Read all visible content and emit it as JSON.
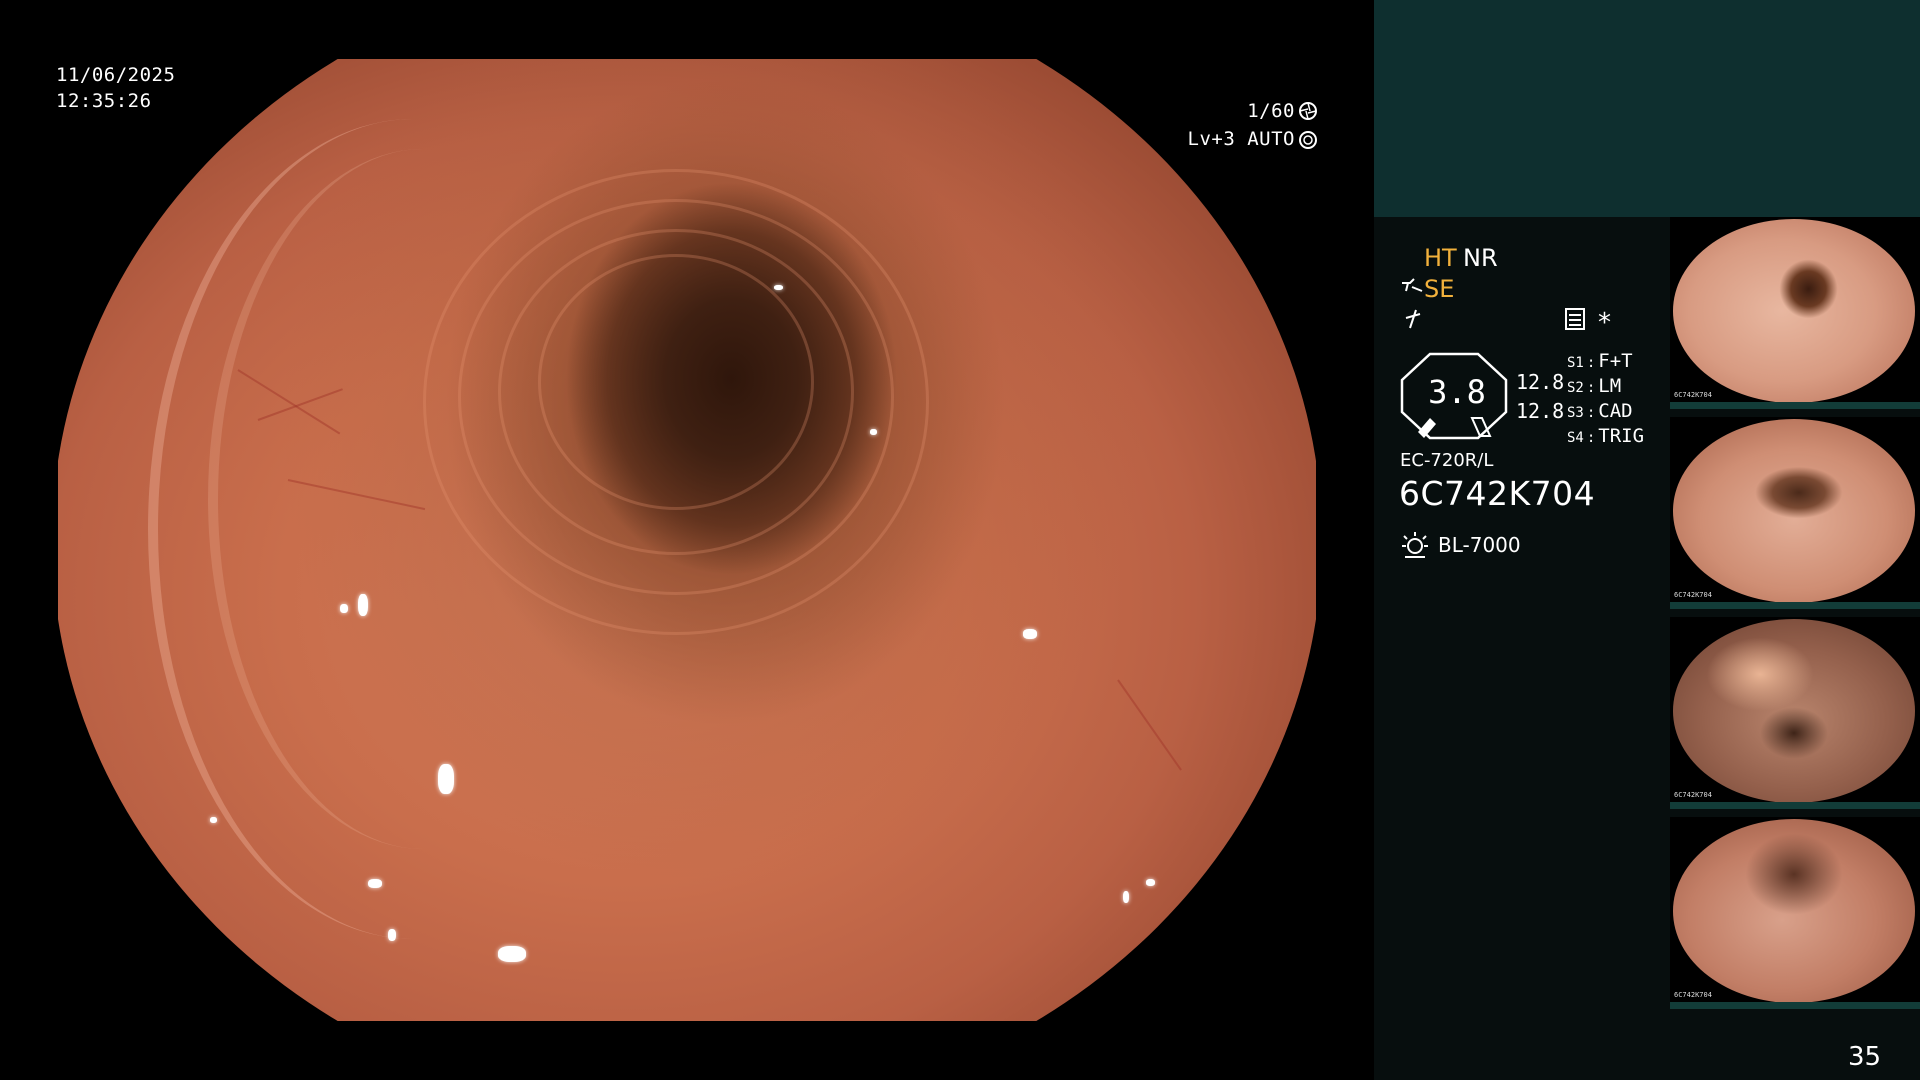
{
  "overlay": {
    "date": "11/06/2025",
    "time": "12:35:26",
    "shutter": "1/60",
    "exposure_level": "Lv+3",
    "exposure_mode": "AUTO"
  },
  "panel": {
    "mode_ht": "HT",
    "mode_nr": "NR",
    "mode_se": "SE",
    "star": "*",
    "gauge_value": "3.8",
    "stat_top": "12.8",
    "stat_bottom": "12.8",
    "switches": [
      {
        "key": "S1",
        "value": "F+T"
      },
      {
        "key": "S2",
        "value": "LM"
      },
      {
        "key": "S3",
        "value": "CAD"
      },
      {
        "key": "S4",
        "value": "TRIG"
      }
    ],
    "scope_model": "EC-720R/L",
    "scope_serial": "6C742K704",
    "light_source": "BL-7000",
    "page_number": "35"
  },
  "colors": {
    "accent_orange": "#f2b13c",
    "panel_top": "#0e2f2f",
    "panel_bg": "#070e0e"
  },
  "thumbnails": [
    {
      "serial": "6C742K704",
      "index": "34"
    },
    {
      "serial": "6C742K704",
      "index": "33"
    },
    {
      "serial": "6C742K704",
      "index": "32"
    },
    {
      "serial": "6C742K704",
      "index": "31"
    }
  ],
  "icons": [
    "shutter-icon",
    "iris-icon",
    "scope-icon",
    "flash-icon",
    "settings-icon",
    "light-source-icon"
  ]
}
